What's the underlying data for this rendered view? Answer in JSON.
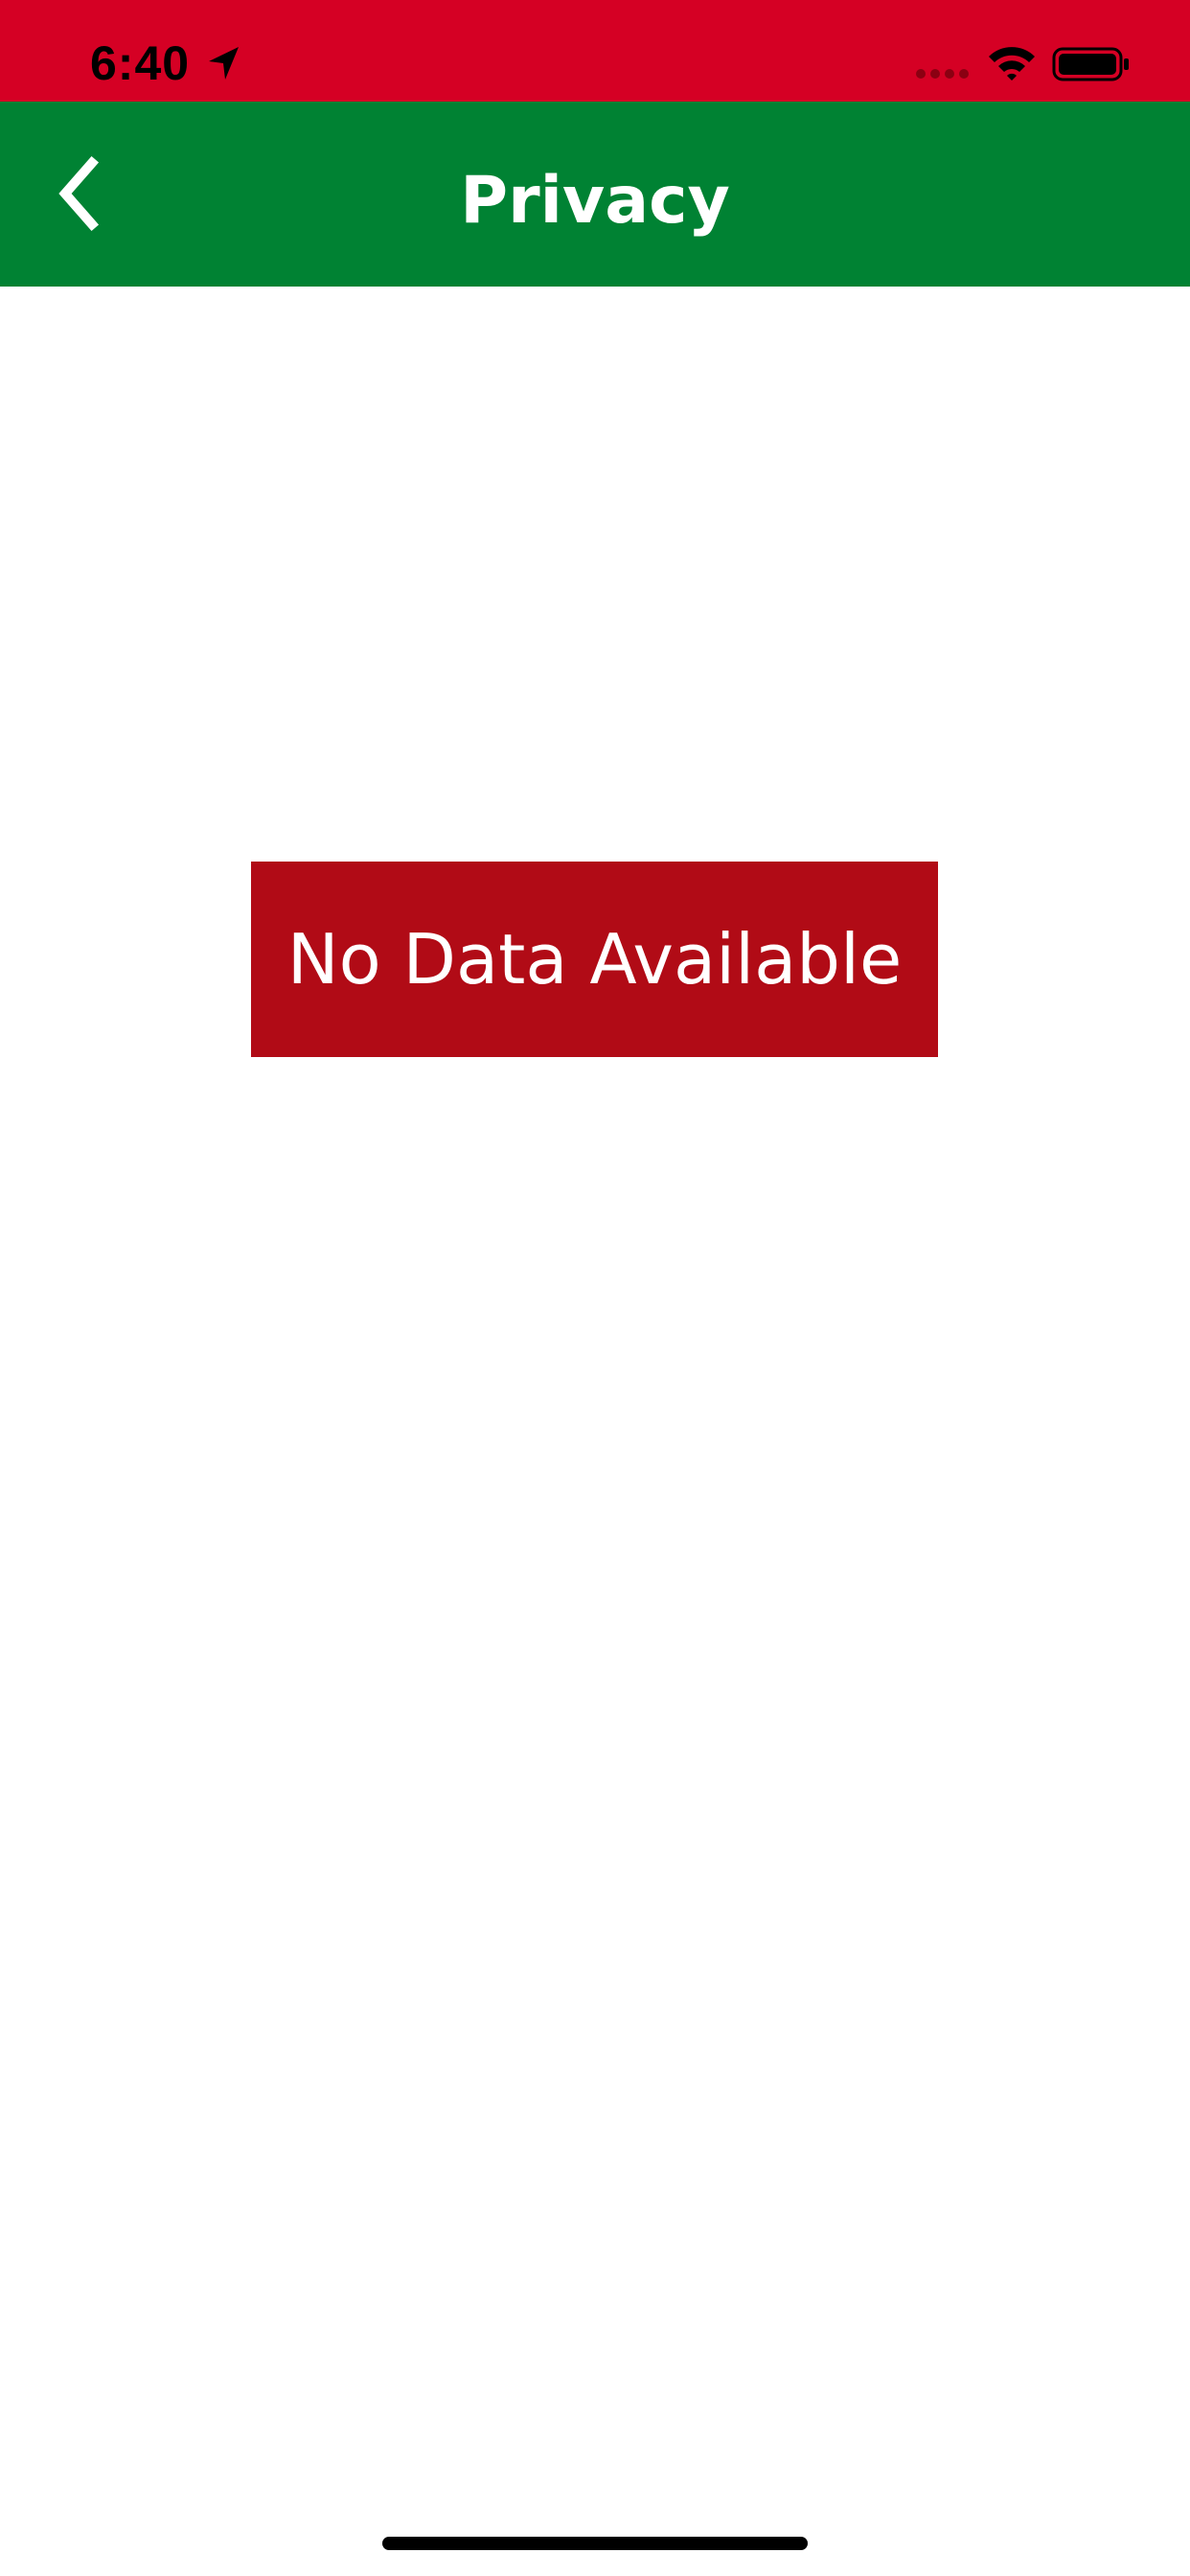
{
  "status_bar": {
    "time": "6:40",
    "background": "#d50024",
    "icons": [
      "location-arrow-icon",
      "signal-icon",
      "wifi-icon",
      "battery-icon"
    ]
  },
  "nav_bar": {
    "title": "Privacy",
    "background": "#008233",
    "back_icon": "chevron-left-icon"
  },
  "main": {
    "empty_message": "No Data Available",
    "empty_background": "#b10b16"
  }
}
